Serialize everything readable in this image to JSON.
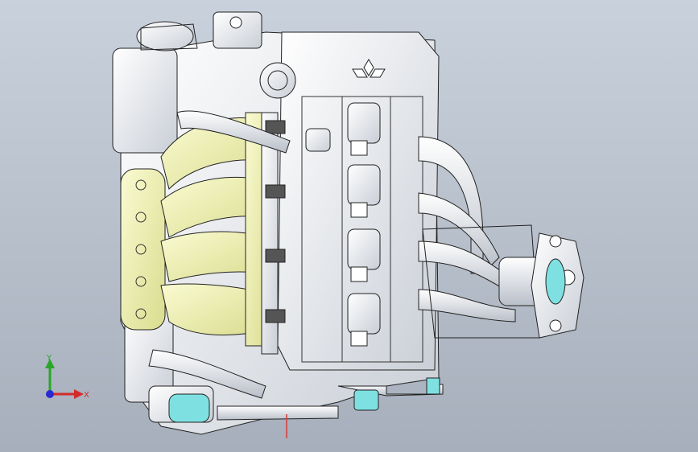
{
  "viewport": {
    "background_top": "#c9d1dc",
    "background_bottom": "#a6afbb"
  },
  "model": {
    "fill_main": "#f2f4f7",
    "fill_manifold": "#eef0b4",
    "fill_accent": "#7fe0e2",
    "fill_red": "#d63a3a"
  },
  "triad": {
    "x_label": "X",
    "y_label": "Y",
    "x_color": "#d42a2a",
    "y_color": "#2aa52a",
    "z_color": "#2a2ad4"
  }
}
